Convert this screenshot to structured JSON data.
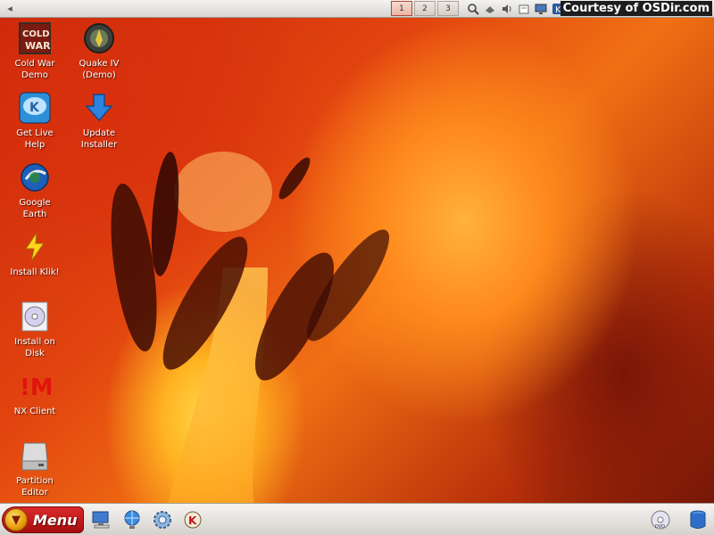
{
  "top_panel": {
    "pager": [
      {
        "label": "1",
        "active": true
      },
      {
        "label": "2",
        "active": false
      },
      {
        "label": "3",
        "active": false
      }
    ],
    "tray_icons": [
      "magnifier-icon",
      "network-icon",
      "volume-icon",
      "clipboard-icon",
      "display-icon",
      "klik-icon",
      "printer-icon"
    ],
    "watermark": "Courtesy of OSDir.com"
  },
  "desktop_icons": [
    {
      "id": "cold-war-demo",
      "label": "Cold War\nDemo",
      "icon": "cold-war-game-icon"
    },
    {
      "id": "quake-iv-demo",
      "label": "Quake IV\n(Demo)",
      "icon": "quake-icon"
    },
    {
      "id": "get-live-help",
      "label": "Get Live\nHelp",
      "icon": "help-chat-icon"
    },
    {
      "id": "update-installer",
      "label": "Update\nInstaller",
      "icon": "download-arrow-icon"
    },
    {
      "id": "google-earth",
      "label": "Google\nEarth",
      "icon": "globe-icon"
    },
    {
      "id": "install-klik",
      "label": "Install Klik!",
      "icon": "lightning-bolt-icon"
    },
    {
      "id": "install-on-disk",
      "label": "Install on\nDisk",
      "icon": "cd-install-icon"
    },
    {
      "id": "nx-client",
      "label": "NX Client",
      "icon": "nx-logo-icon"
    },
    {
      "id": "partition-editor",
      "label": "Partition\nEditor",
      "icon": "hard-drive-icon"
    }
  ],
  "bottom_panel": {
    "menu_label": "Menu",
    "quick_launch": [
      "computer-icon",
      "network-globe-icon",
      "settings-gear-icon",
      "konqueror-icon"
    ],
    "right_icons": [
      "cd-drive-icon",
      "database-drive-icon"
    ]
  },
  "colors": {
    "menu_red": "#c41a1a",
    "wallpaper_orange": "#f07014"
  }
}
